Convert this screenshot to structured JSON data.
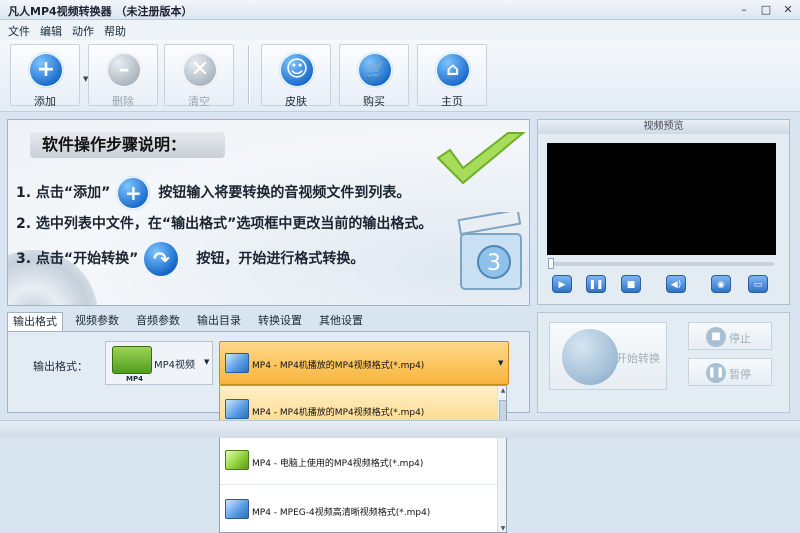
{
  "window": {
    "title": "凡人MP4视频转换器 （未注册版本）",
    "buttons": [
      "–",
      "□",
      "✕"
    ]
  },
  "menu": [
    "文件",
    "编辑",
    "动作",
    "帮助"
  ],
  "toolbar": {
    "add": "添加",
    "delete": "删除",
    "clear": "清空",
    "skin": "皮肤",
    "buy": "购买",
    "home": "主页"
  },
  "guide": {
    "heading": "软件操作步骤说明：",
    "step1_pre": "1. 点击“添加”",
    "step1_post": "按钮输入将要转换的音视频文件到列表。",
    "step2": "2. 选中列表中文件，在“输出格式”选项框中更改当前的输出格式。",
    "step3_pre": "3. 点击“开始转换”",
    "step3_post": "按钮，开始进行格式转换。"
  },
  "preview": {
    "title": "视频预览",
    "controls": [
      "play-icon",
      "pause-icon",
      "stop-icon",
      "volume-icon",
      "snapshot-icon",
      "folder-icon"
    ]
  },
  "tabs": [
    "输出格式",
    "视频参数",
    "音频参数",
    "输出目录",
    "转换设置",
    "其他设置"
  ],
  "output": {
    "label": "输出格式：",
    "format_name": "MP4视频",
    "format_icon_text": "MP4",
    "selected": "MP4 - MP4机播放的MP4视频格式(*.mp4)",
    "options": [
      "MP4 - MP4机播放的MP4视频格式(*.mp4)",
      "MP4 - 电脑上使用的MP4视频格式(*.mp4)",
      "MP4 - MPEG-4视频高清晰视频格式(*.mp4)"
    ]
  },
  "actions": {
    "start": "开始转换",
    "stop": "停止",
    "pause": "暂停"
  }
}
